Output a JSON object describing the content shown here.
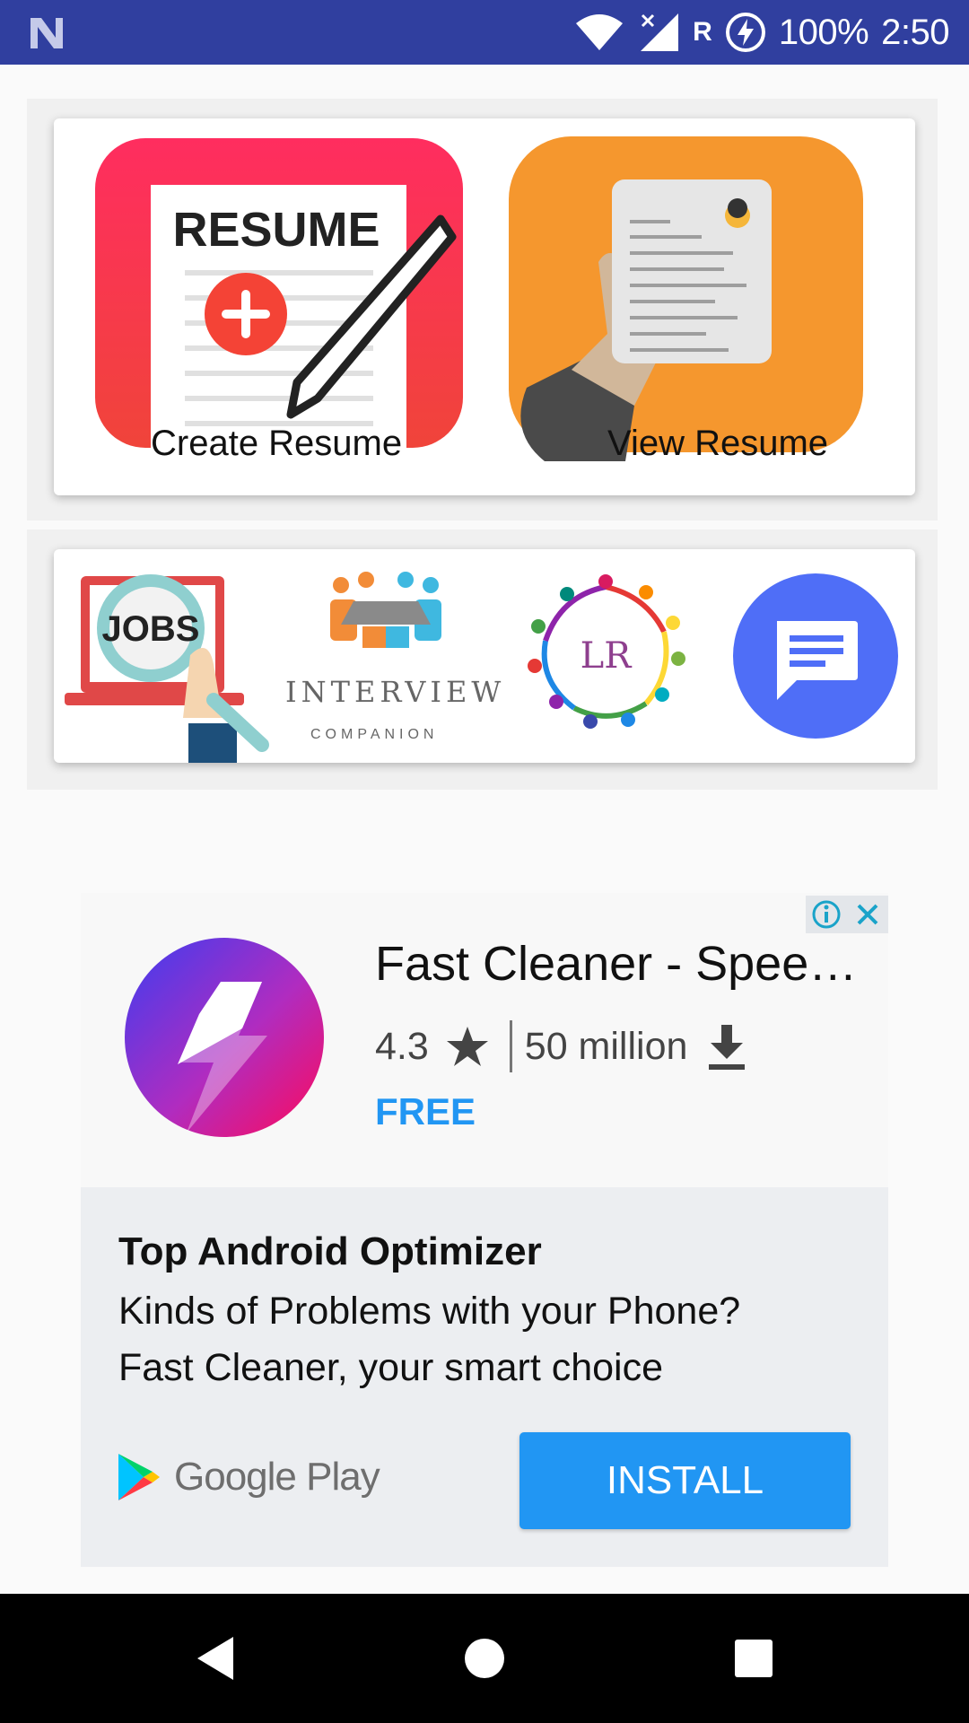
{
  "status_bar": {
    "battery_percent": "100%",
    "time": "2:50",
    "roaming_indicator": "R",
    "icons": [
      "notification-n-icon",
      "wifi-icon",
      "cell-signal-icon",
      "battery-charging-icon"
    ],
    "background_color": "#303f9f"
  },
  "main_tiles": {
    "create_resume_label": "Create Resume",
    "create_resume_art_text": "RESUME",
    "view_resume_label": "View Resume"
  },
  "quick_links": {
    "jobs_text": "JOBS",
    "interview_title": "INTERVIEW",
    "interview_subtitle": "COMPANION",
    "lr_text": "LR"
  },
  "ad": {
    "app_title": "Fast Cleaner - Spee…",
    "rating": "4.3",
    "downloads": "50 million",
    "price": "FREE",
    "headline": "Top Android Optimizer",
    "body_line1": "Kinds of Problems with your Phone?",
    "body_line2": "Fast Cleaner, your smart choice",
    "store_label": "Google Play",
    "install_label": "INSTALL",
    "accent_color": "#2196f3"
  },
  "nav_bar": {
    "buttons": [
      "back-icon",
      "home-icon",
      "recents-icon"
    ]
  }
}
